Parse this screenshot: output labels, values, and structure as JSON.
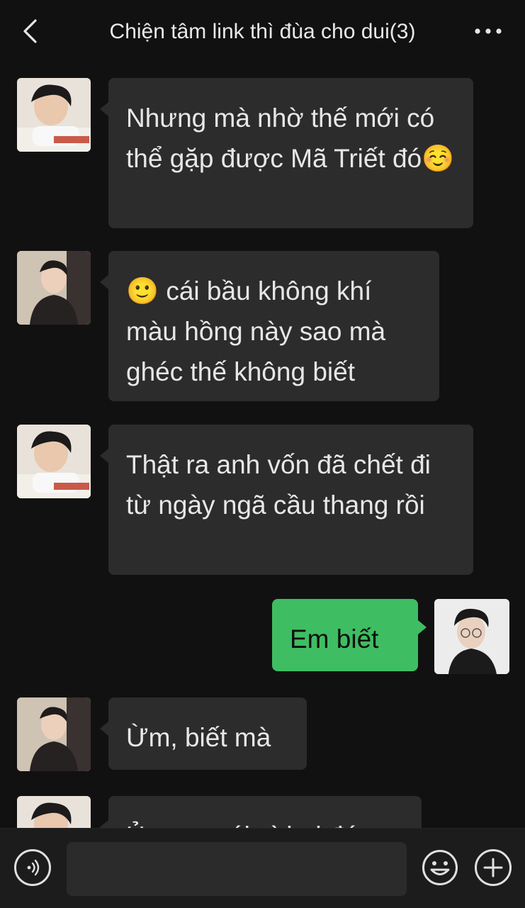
{
  "header": {
    "title": "Chiện tâm link thì đùa cho dui(3)",
    "back_icon": "chevron-left-icon",
    "more_icon": "ellipsis-icon"
  },
  "messages": [
    {
      "side": "left",
      "avatar": "contact-a",
      "text": "Nhưng mà nhờ thế mới có thể gặp được Mã Triết đó☺️"
    },
    {
      "side": "left",
      "avatar": "contact-b",
      "text": "🙂 cái bầu không khí màu hồng này sao mà ghéc thế không biết"
    },
    {
      "side": "left",
      "avatar": "contact-a",
      "text": "Thật ra anh vốn đã chết đi từ ngày ngã cầu thang rồi"
    },
    {
      "side": "right",
      "avatar": "self",
      "text": "Em biết"
    },
    {
      "side": "left",
      "avatar": "contact-b",
      "text": "Ừm, biết mà"
    },
    {
      "side": "left",
      "avatar": "contact-a",
      "text": "Ủa sao cái gì hai đứa"
    }
  ],
  "footer": {
    "voice_icon": "voice-icon",
    "input_value": "",
    "emoji_icon": "smiley-icon",
    "plus_icon": "plus-icon"
  },
  "colors": {
    "background": "#111111",
    "bubble_incoming": "#2c2c2c",
    "bubble_outgoing": "#3fbd62",
    "footer": "#1c1c1c"
  }
}
